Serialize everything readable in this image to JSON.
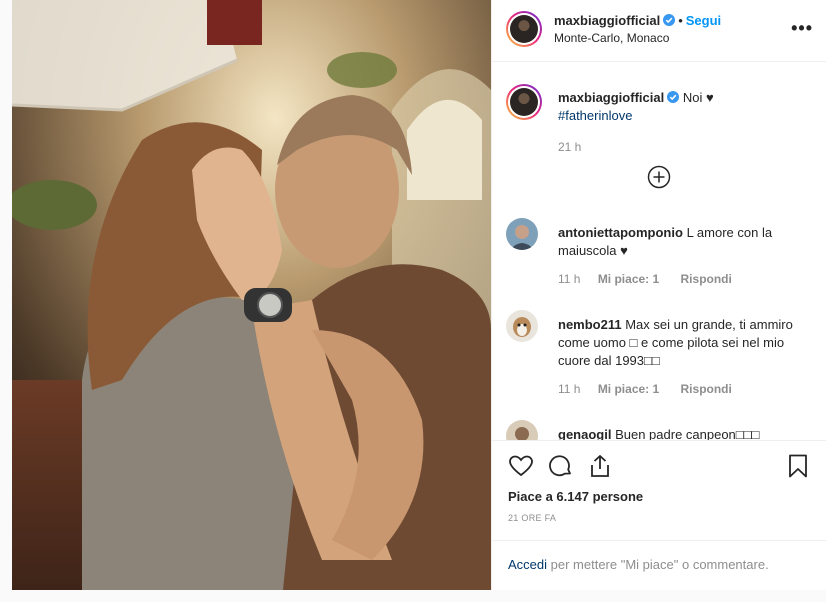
{
  "post": {
    "username": "maxbiaggiofficial",
    "follow_label": "Segui",
    "location": "Monte-Carlo, Monaco",
    "more_label": "•••"
  },
  "caption": {
    "username": "maxbiaggiofficial",
    "text": "Noi ♥",
    "hashtag": "#fatherinlove",
    "time": "21 h"
  },
  "comments": [
    {
      "username": "antoniettapomponio",
      "text": "L amore con la maiuscola ♥",
      "time": "11 h",
      "likes": "Mi piace: 1",
      "reply": "Rispondi"
    },
    {
      "username": "nembo211",
      "text": "Max sei un grande, ti ammiro come uomo □ e come pilota sei nel mio cuore dal 1993□□",
      "time": "11 h",
      "likes": "Mi piace: 1",
      "reply": "Rispondi"
    },
    {
      "username": "genaogil",
      "text": "Buen padre canpeon□□□"
    }
  ],
  "likes_text": "Piace a 6.147 persone",
  "timestamp": "21 ORE FA",
  "login": {
    "link": "Accedi",
    "text": " per mettere \"Mi piace\" o commentare."
  },
  "icons": {
    "verified": "verified-badge-icon",
    "heart": "heart-icon",
    "comment": "comment-icon",
    "share": "share-icon",
    "bookmark": "bookmark-icon",
    "plus": "plus-circle-icon"
  },
  "colors": {
    "accent": "#0095f6",
    "link": "#00376b",
    "muted": "#8e8e8e"
  }
}
